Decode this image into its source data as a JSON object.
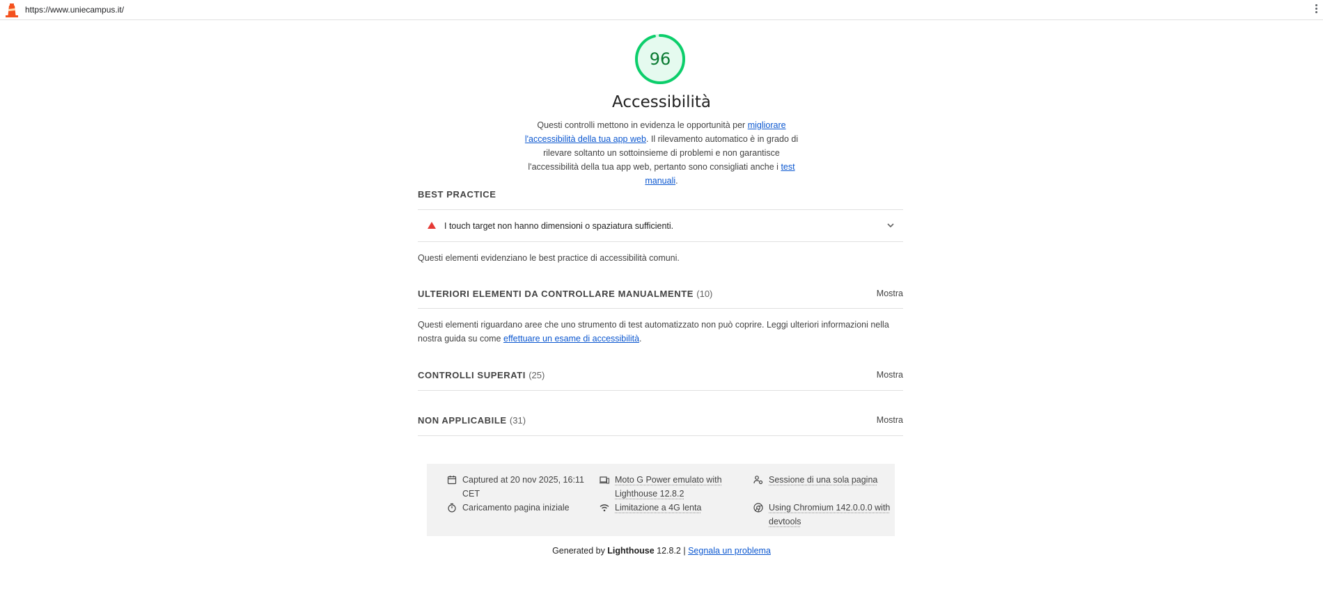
{
  "browser": {
    "url": "https://www.uniecampus.it/",
    "logo_icon": "lighthouse-icon",
    "menu_icon": "kebab-menu-icon"
  },
  "gauge": {
    "score": "96",
    "score_fraction": 0.96,
    "color": "#0cce6b",
    "text_color": "#0a7a32"
  },
  "category": {
    "title": "Accessibilità",
    "desc_part1": "Questi controlli mettono in evidenza le opportunità per ",
    "desc_link1": "migliorare l'accessibilità della tua app web",
    "desc_part2": ". Il rilevamento automatico è in grado di rilevare soltanto un sottoinsieme di problemi e non garantisce l'accessibilità della tua app web, pertanto sono consigliati anche i ",
    "desc_link2": "test manuali",
    "desc_part3": "."
  },
  "best_practice": {
    "title": "BEST PRACTICE",
    "audit_label": "I touch target non hanno dimensioni o spaziatura sufficienti.",
    "audit_icon": "warning-triangle-icon",
    "note": "Questi elementi evidenziano le best practice di accessibilità comuni."
  },
  "manual": {
    "title": "ULTERIORI ELEMENTI DA CONTROLLARE MANUALMENTE",
    "count": "(10)",
    "show_label": "Mostra",
    "note_part1": "Questi elementi riguardano aree che uno strumento di test automatizzato non può coprire. Leggi ulteriori informazioni nella nostra guida su come ",
    "note_link": "effettuare un esame di accessibilità",
    "note_part2": "."
  },
  "passed": {
    "title": "CONTROLLI SUPERATI",
    "count": "(25)",
    "show_label": "Mostra"
  },
  "not_applicable": {
    "title": "NON APPLICABILE",
    "count": "(31)",
    "show_label": "Mostra"
  },
  "info": {
    "captured_line1": "Captured at 20 nov 2025, 16:11",
    "captured_line2": "CET",
    "load": "Caricamento pagina iniziale",
    "device_line1": "Moto G Power emulato with",
    "device_line2": "Lighthouse 12.8.2",
    "throttle": "Limitazione a 4G lenta",
    "session": "Sessione di una sola pagina",
    "browser_line1": "Using Chromium 142.0.0.0 with",
    "browser_line2": "devtools"
  },
  "footer": {
    "generated_by": "Generated by ",
    "product": "Lighthouse",
    "version": " 12.8.2 | ",
    "report_link": "Segnala un problema"
  }
}
